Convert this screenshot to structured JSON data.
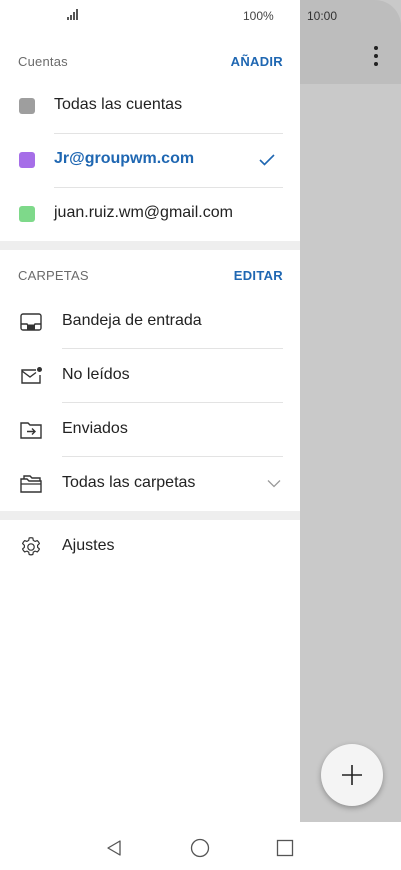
{
  "status_bar": {
    "battery_percent": "100%",
    "time": "10:00"
  },
  "accounts": {
    "title": "Cuentas",
    "action": "AÑADIR",
    "items": [
      {
        "label": "Todas las cuentas",
        "color": "#9e9e9e",
        "selected": false
      },
      {
        "label": "Jr@groupwm.com",
        "color": "#a66ee8",
        "selected": true
      },
      {
        "label": "juan.ruiz.wm@gmail.com",
        "color": "#7ed98a",
        "selected": false
      }
    ]
  },
  "folders": {
    "title": "CARPETAS",
    "action": "EDITAR",
    "items": [
      {
        "label": "Bandeja de entrada",
        "icon": "inbox-icon"
      },
      {
        "label": "No leídos",
        "icon": "unread-mail-icon"
      },
      {
        "label": "Enviados",
        "icon": "sent-folder-icon"
      },
      {
        "label": "Todas las carpetas",
        "icon": "all-folders-icon"
      }
    ]
  },
  "settings": {
    "label": "Ajustes",
    "icon": "gear-icon"
  },
  "colors": {
    "accent": "#1f67b2",
    "scrim": "#c9c9c9"
  }
}
